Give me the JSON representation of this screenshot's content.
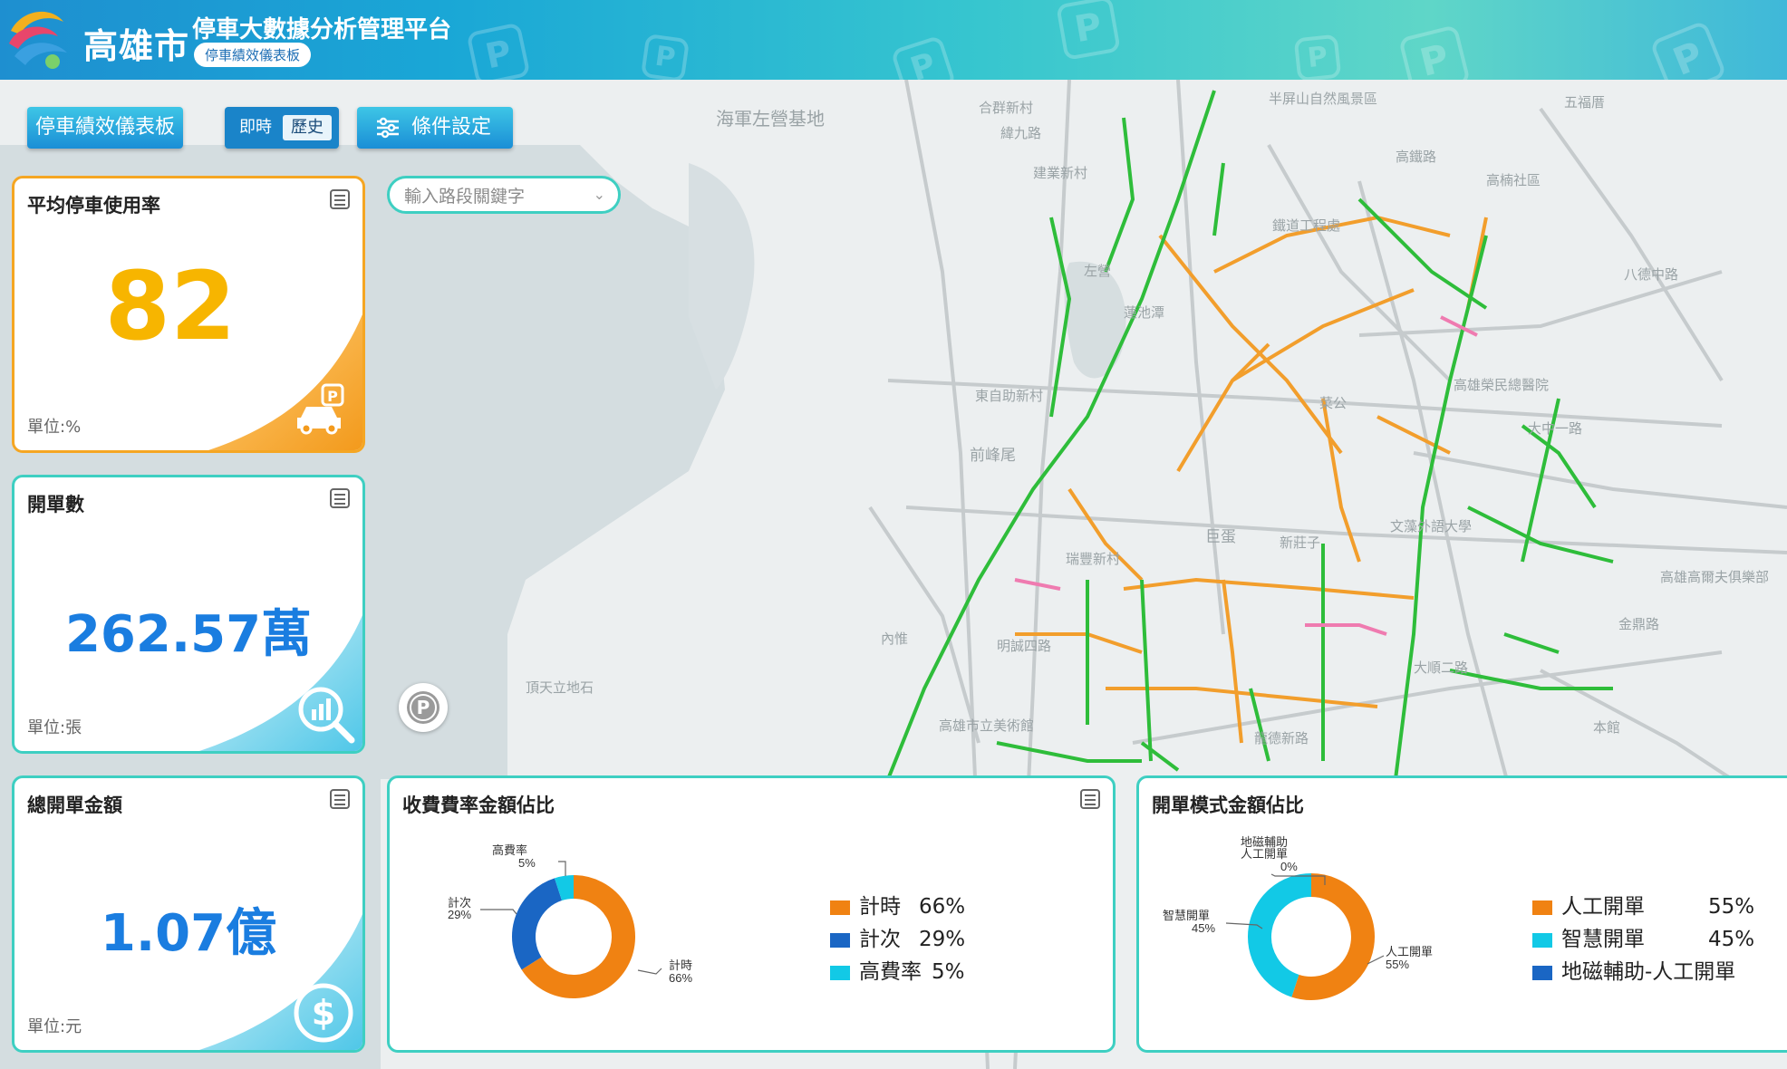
{
  "header": {
    "city": "高雄市",
    "platform_title": "停車大數據分析管理平台",
    "subtitle": "停車績效儀表板"
  },
  "toolbar": {
    "dashboard_button": "停車績效儀表板",
    "mode_realtime": "即時",
    "mode_history": "歷史",
    "condition_button": "條件設定"
  },
  "search": {
    "placeholder": "輸入路段關鍵字"
  },
  "kpi": {
    "usage": {
      "title": "平均停車使用率",
      "value": "82",
      "unit": "單位:%",
      "color": "#f5b400"
    },
    "tickets": {
      "title": "開單數",
      "value": "262.57萬",
      "unit": "單位:張",
      "color": "#1a7de0"
    },
    "amount": {
      "title": "總開單金額",
      "value": "1.07億",
      "unit": "單位:元",
      "color": "#1a7de0"
    }
  },
  "rate_panel": {
    "title": "收費費率金額佔比",
    "slices": [
      {
        "name": "計時",
        "percent": 66,
        "pct_label": "66%",
        "color": "#f08212"
      },
      {
        "name": "計次",
        "percent": 29,
        "pct_label": "29%",
        "color": "#1a66c4"
      },
      {
        "name": "高費率",
        "percent": 5,
        "pct_label": "5%",
        "color": "#12c9e6"
      }
    ]
  },
  "mode_panel": {
    "title": "開單模式金額佔比",
    "slices": [
      {
        "name": "人工開單",
        "percent": 55,
        "pct_label": "55%",
        "color": "#f08212"
      },
      {
        "name": "智慧開單",
        "percent": 45,
        "pct_label": "45%",
        "color": "#12c9e6"
      },
      {
        "name": "地磁輔助-人工開單",
        "percent": 0,
        "pct_label": "0%",
        "color": "#1a66c4"
      }
    ],
    "callout_name_line1": "地磁輔助",
    "callout_name_line2": "人工開單",
    "legend_pct_cut": "0%"
  },
  "map": {
    "labels": [
      {
        "text": "海軍左營基地"
      },
      {
        "text": "半屏山自然風景區"
      },
      {
        "text": "合群新村"
      },
      {
        "text": "緯九路"
      },
      {
        "text": "建業新村"
      },
      {
        "text": "左營"
      },
      {
        "text": "鐵道工程處"
      },
      {
        "text": "蓮池潭"
      },
      {
        "text": "菜公"
      },
      {
        "text": "高鐵路"
      },
      {
        "text": "高楠社區"
      },
      {
        "text": "五福厝"
      },
      {
        "text": "八德中路"
      },
      {
        "text": "高雄榮民總醫院"
      },
      {
        "text": "大中一路"
      },
      {
        "text": "東自助新村"
      },
      {
        "text": "前峰尾"
      },
      {
        "text": "巨蛋"
      },
      {
        "text": "新莊子"
      },
      {
        "text": "文藻外語大學"
      },
      {
        "text": "高雄高爾夫俱樂部"
      },
      {
        "text": "瑞豐新村"
      },
      {
        "text": "內惟"
      },
      {
        "text": "頂天立地石"
      },
      {
        "text": "高雄市立美術館"
      },
      {
        "text": "龍德新路"
      },
      {
        "text": "本館"
      },
      {
        "text": "金鼎路"
      },
      {
        "text": "明誠四路"
      },
      {
        "text": "大順二路"
      }
    ]
  }
}
